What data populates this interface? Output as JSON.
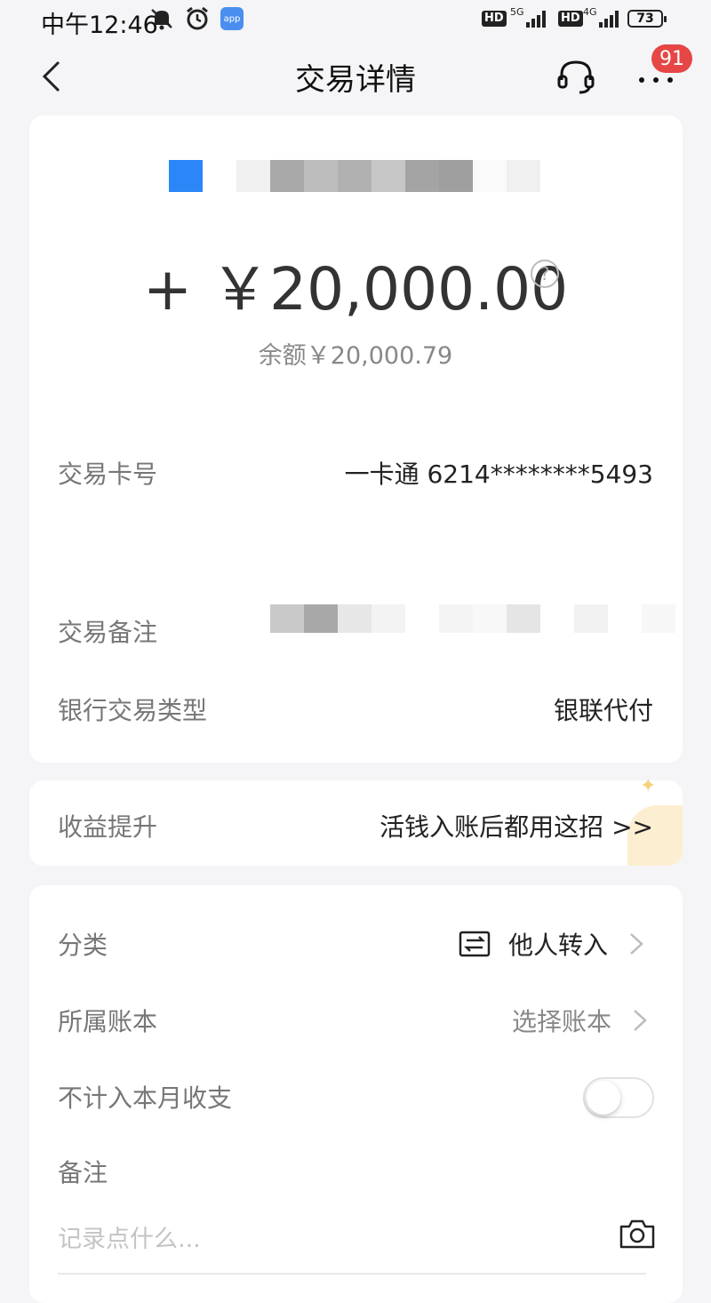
{
  "status_bar": {
    "time": "中午12:46",
    "app_icon_label": "app",
    "net1_label": "5G",
    "net2_label": "4G",
    "hd_label": "HD",
    "battery": "73"
  },
  "nav": {
    "title": "交易详情",
    "badge_count": "91"
  },
  "summary": {
    "amount": "+ ￥20,000.00",
    "help_glyph": "?",
    "balance": "余额￥20,000.79"
  },
  "details": {
    "card_label": "交易卡号",
    "card_value": "一卡通 6214********5493",
    "remark_label": "交易备注",
    "bank_type_label": "银行交易类型",
    "bank_type_value": "银联代付"
  },
  "promo": {
    "label": "收益提升",
    "link": "活钱入账后都用这招 >>"
  },
  "meta": {
    "category_label": "分类",
    "category_value": "他人转入",
    "ledger_label": "所属账本",
    "ledger_value": "选择账本",
    "exclude_label": "不计入本月收支",
    "exclude_on": false,
    "note_label": "备注",
    "note_placeholder": "记录点什么..."
  },
  "colors": {
    "accent_blue": "#2b86f7",
    "badge_red": "#e64646",
    "background": "#f5f5f7"
  }
}
